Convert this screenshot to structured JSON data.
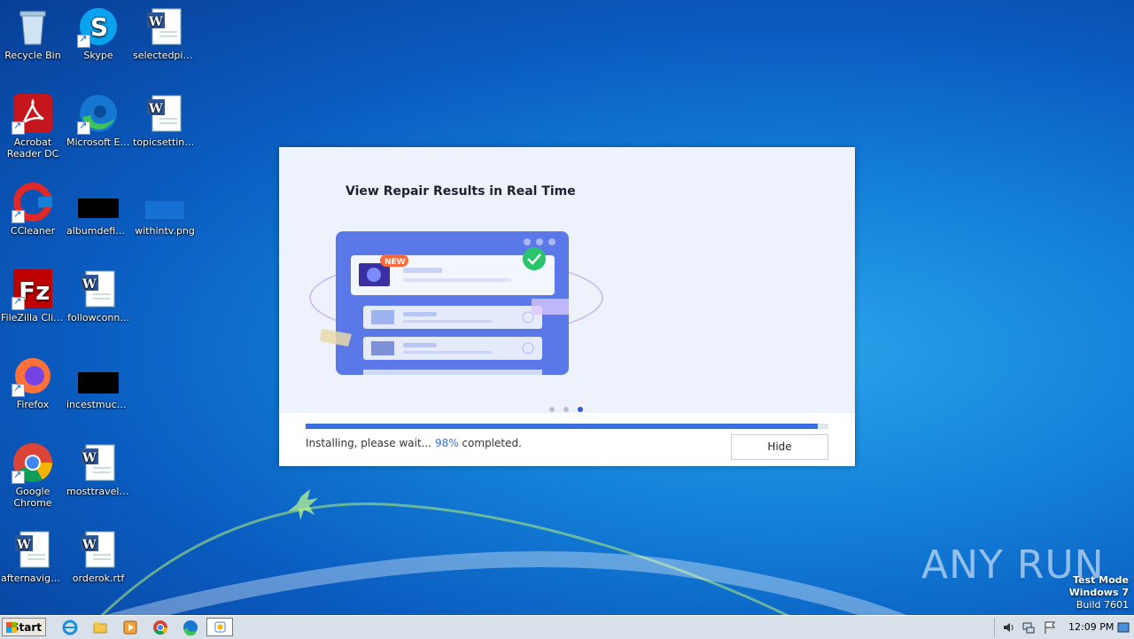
{
  "desktop": {
    "icons": [
      {
        "label": "Recycle Bin"
      },
      {
        "label": "Skype"
      },
      {
        "label": "selectedpie..."
      },
      {
        "label": "Acrobat Reader DC"
      },
      {
        "label": "Microsoft Edge"
      },
      {
        "label": "topicsetting..."
      },
      {
        "label": "CCleaner"
      },
      {
        "label": "albumdefini..."
      },
      {
        "label": "withintv.png"
      },
      {
        "label": "FileZilla Client"
      },
      {
        "label": "followconn..."
      },
      {
        "label": "Firefox"
      },
      {
        "label": "incestmuch..."
      },
      {
        "label": "Google Chrome"
      },
      {
        "label": "mosttravel.rtf"
      },
      {
        "label": "afternaviga..."
      },
      {
        "label": "orderok.rtf"
      }
    ]
  },
  "dialog": {
    "title": "View Repair Results in Real Time",
    "badge": "NEW",
    "status_prefix": "Installing, please wait...",
    "status_percent": "98%",
    "status_suffix": "completed.",
    "progress": 0.98,
    "hide_label": "Hide",
    "carousel_active": 3,
    "accent": "#3b6fe0"
  },
  "watermark": {
    "text": "ANY RUN",
    "mode": "Test Mode",
    "os": "Windows 7",
    "build": "Build 7601"
  },
  "taskbar": {
    "start_label": "Start",
    "clock": "12:09 PM"
  }
}
